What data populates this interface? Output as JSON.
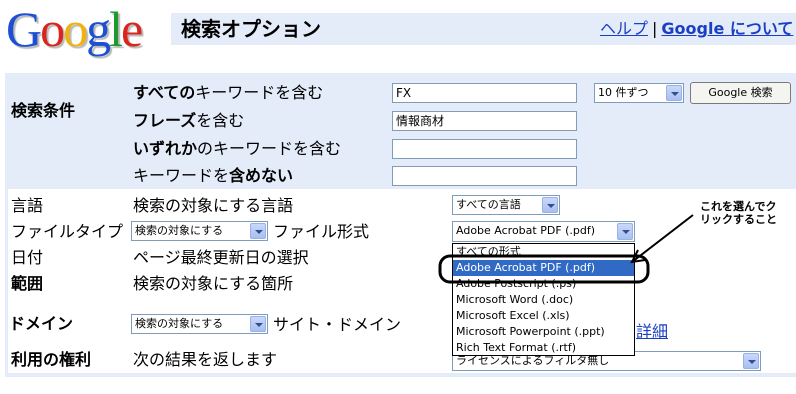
{
  "logo": {
    "letters": [
      "G",
      "o",
      "o",
      "g",
      "l",
      "e"
    ],
    "text": "Google"
  },
  "header": {
    "title": "検索オプション",
    "help_link": "ヘルプ",
    "separator": "|",
    "about_link": "Google について"
  },
  "keywords": {
    "section_label": "検索条件",
    "all_words_label_a": "すべての",
    "all_words_label_b": "キーワードを含む",
    "all_words_value": "FX",
    "phrase_label_a": "フレーズ",
    "phrase_label_b": "を含む",
    "phrase_value": "情報商材",
    "any_words_label_a": "いずれか",
    "any_words_label_b": "のキーワードを含む",
    "any_words_value": "",
    "exclude_label_a": "キーワードを",
    "exclude_label_b": "含めない",
    "exclude_value": "",
    "results_per_page": "10 件ずつ",
    "search_button": "Google 検索"
  },
  "language": {
    "label": "言語",
    "description": "検索の対象にする言語",
    "value": "すべての言語"
  },
  "filetype": {
    "label": "ファイルタイプ",
    "mode_value": "検索の対象にする",
    "description": "ファイル形式",
    "value": "Adobe Acrobat PDF (.pdf)",
    "options": [
      "すべての形式",
      "Adobe Acrobat PDF (.pdf)",
      "Adobe Postscript (.ps)",
      "Microsoft Word (.doc)",
      "Microsoft Excel (.xls)",
      "Microsoft Powerpoint (.ppt)",
      "Rich Text Format (.rtf)"
    ],
    "selected_index": 1
  },
  "date": {
    "label": "日付",
    "description": "ページ最終更新日の選択"
  },
  "occurrence": {
    "label": "範囲",
    "description": "検索の対象にする箇所"
  },
  "domain": {
    "label": "ドメイン",
    "mode_value": "検索の対象にする",
    "description": "サイト・ドメイン",
    "detail_link": "詳細"
  },
  "usage_rights": {
    "label": "利用の権利",
    "description": "次の結果を返します",
    "value": "ライセンスによるフィルタ無し"
  },
  "annotation": {
    "line1": "これを選んでク",
    "line2": "リックすること"
  }
}
